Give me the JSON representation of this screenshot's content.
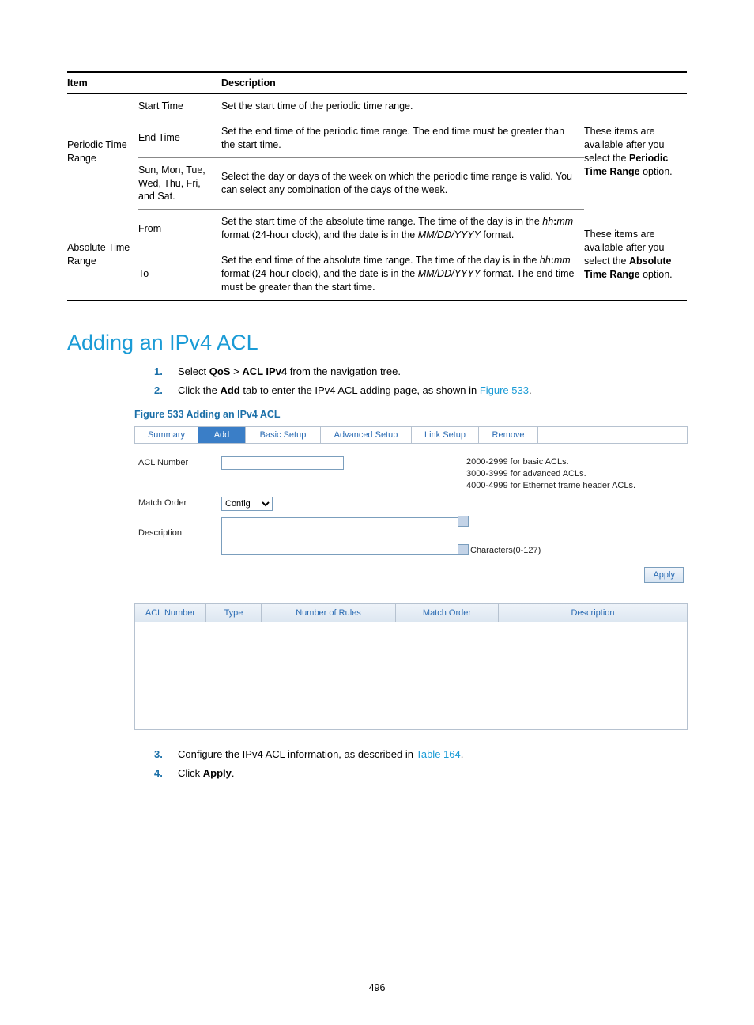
{
  "table": {
    "head": {
      "item": "Item",
      "desc": "Description"
    },
    "periodic": {
      "label": "Periodic Time Range",
      "note_pre": "These items are available after you select the ",
      "note_bold": "Periodic Time Range",
      "note_post": " option.",
      "rows": [
        {
          "sub": "Start Time",
          "desc": "Set the start time of the periodic time range."
        },
        {
          "sub": "End Time",
          "desc": "Set the end time of the periodic time range. The end time must be greater than the start time."
        },
        {
          "sub": "Sun, Mon, Tue, Wed, Thu, Fri, and Sat.",
          "desc": "Select the day or days of the week on which the periodic time range is valid. You can select any combination of the days of the week."
        }
      ]
    },
    "absolute": {
      "label": "Absolute Time Range",
      "note_pre": "These items are available after you select the ",
      "note_bold": "Absolute Time Range",
      "note_post": " option.",
      "rows": [
        {
          "sub": "From",
          "d1": "Set the start time of the absolute time range. The time of the day is in the ",
          "it1": "hh",
          "colon1": ":",
          "it2": "mm",
          "d2": " format (24-hour clock), and the date is in the ",
          "it3": "MM/DD/YYYY",
          "d3": " format."
        },
        {
          "sub": "To",
          "d1": "Set the end time of the absolute time range. The time of the day is in the ",
          "it1": "hh",
          "colon1": ":",
          "it2": "mm",
          "d2": " format (24-hour clock), and the date is in the ",
          "it3": "MM/DD/YYYY",
          "d3": " format. The end time must be greater than the start time."
        }
      ]
    }
  },
  "heading": "Adding an IPv4 ACL",
  "steps": {
    "s1_a": "Select ",
    "s1_b1": "QoS",
    "s1_mid": " > ",
    "s1_b2": "ACL IPv4",
    "s1_c": " from the navigation tree.",
    "s2_a": "Click the ",
    "s2_b": "Add",
    "s2_c": " tab to enter the IPv4 ACL adding page, as shown in ",
    "s2_link": "Figure 533",
    "s2_d": ".",
    "s3_a": "Configure the IPv4 ACL information, as described in ",
    "s3_link": "Table 164",
    "s3_b": ".",
    "s4_a": "Click ",
    "s4_b": "Apply",
    "s4_c": "."
  },
  "figure_caption": "Figure 533 Adding an IPv4 ACL",
  "ui": {
    "tabs": [
      "Summary",
      "Add",
      "Basic Setup",
      "Advanced Setup",
      "Link Setup",
      "Remove"
    ],
    "form": {
      "acl_number_label": "ACL Number",
      "acl_hint1": "2000-2999 for basic ACLs.",
      "acl_hint2": "3000-3999 for advanced ACLs.",
      "acl_hint3": "4000-4999 for Ethernet frame header ACLs.",
      "match_order_label": "Match Order",
      "match_order_value": "Config",
      "description_label": "Description",
      "char_hint": "Characters(0-127)"
    },
    "apply": "Apply",
    "grid_headers": [
      "ACL Number",
      "Type",
      "Number of Rules",
      "Match Order",
      "Description"
    ]
  },
  "page_number": "496"
}
